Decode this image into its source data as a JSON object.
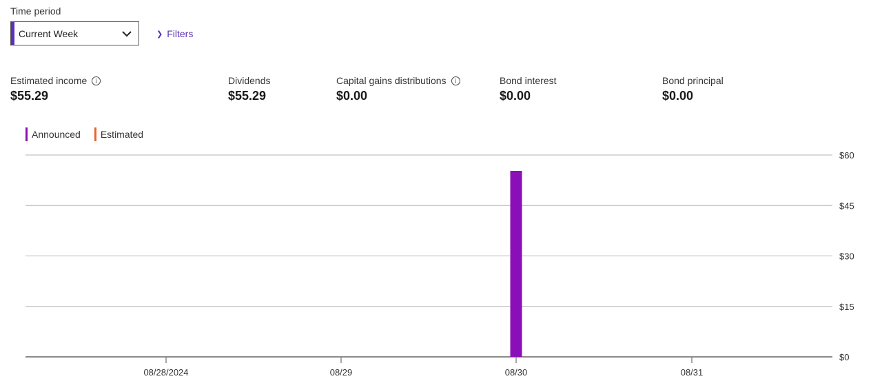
{
  "time_period": {
    "label": "Time period",
    "selected": "Current Week"
  },
  "filters_label": "Filters",
  "metrics": [
    {
      "label": "Estimated income",
      "value": "$55.29",
      "info": true
    },
    {
      "label": "Dividends",
      "value": "$55.29",
      "info": false
    },
    {
      "label": "Capital gains distributions",
      "value": "$0.00",
      "info": true
    },
    {
      "label": "Bond interest",
      "value": "$0.00",
      "info": false
    },
    {
      "label": "Bond principal",
      "value": "$0.00",
      "info": false
    }
  ],
  "legend": [
    {
      "label": "Announced",
      "color": "#8a0fb8"
    },
    {
      "label": "Estimated",
      "color": "#e8642c"
    }
  ],
  "chart_data": {
    "type": "bar",
    "categories": [
      "08/28/2024",
      "08/29",
      "08/30",
      "08/31"
    ],
    "series": [
      {
        "name": "Announced",
        "color": "#8a0fb8",
        "values": [
          0,
          0,
          55.29,
          0
        ]
      },
      {
        "name": "Estimated",
        "color": "#e8642c",
        "values": [
          0,
          0,
          0,
          0
        ]
      }
    ],
    "y_ticks": [
      "$60",
      "$45",
      "$30",
      "$15",
      "$0"
    ],
    "ylim": [
      0,
      60
    ],
    "grid": true,
    "yaxis_position": "right"
  }
}
